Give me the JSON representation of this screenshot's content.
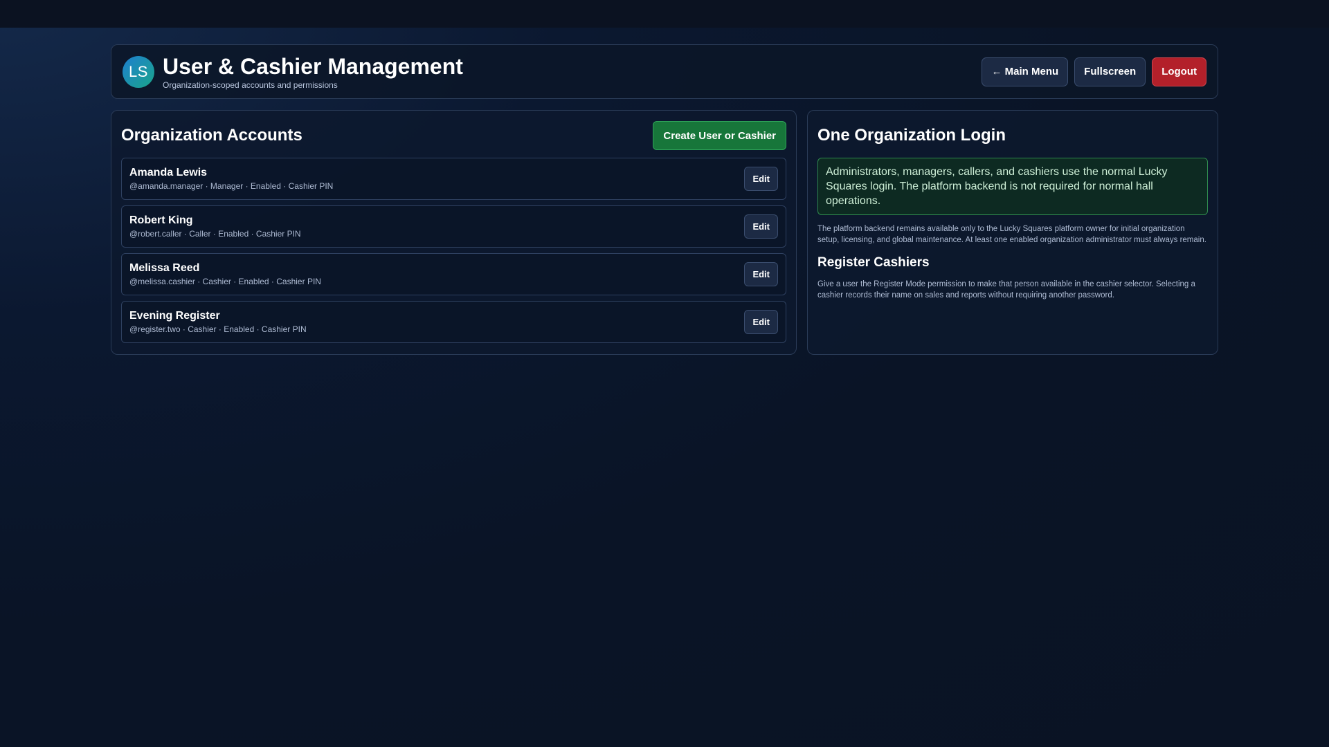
{
  "header": {
    "logo_text": "LS",
    "title": "User & Cashier Management",
    "subtitle": "Organization-scoped accounts and permissions",
    "buttons": {
      "main_menu": "← Main Menu",
      "fullscreen": "Fullscreen",
      "logout": "Logout"
    }
  },
  "accounts_panel": {
    "title": "Organization Accounts",
    "create_label": "Create User or Cashier",
    "edit_label": "Edit",
    "accounts": [
      {
        "name": "Amanda Lewis",
        "meta": "@amanda.manager · Manager · Enabled · Cashier PIN"
      },
      {
        "name": "Robert King",
        "meta": "@robert.caller · Caller · Enabled · Cashier PIN"
      },
      {
        "name": "Melissa Reed",
        "meta": "@melissa.cashier · Cashier · Enabled · Cashier PIN"
      },
      {
        "name": "Evening Register",
        "meta": "@register.two · Cashier · Enabled · Cashier PIN"
      }
    ]
  },
  "info_panel": {
    "title": "One Organization Login",
    "notice": "Administrators, managers, callers, and cashiers use the normal Lucky Squares login. The platform backend is not required for normal hall operations.",
    "backend_note": "The platform backend remains available only to the Lucky Squares platform owner for initial organization setup, licensing, and global maintenance. At least one enabled organization administrator must always remain.",
    "register_title": "Register Cashiers",
    "register_text": "Give a user the Register Mode permission to make that person available in the cashier selector. Selecting a cashier records their name on sales and reports without requiring another password."
  },
  "colors": {
    "background": "#0a1426",
    "accent_green": "#17763a",
    "logout_red": "#b3202a"
  }
}
